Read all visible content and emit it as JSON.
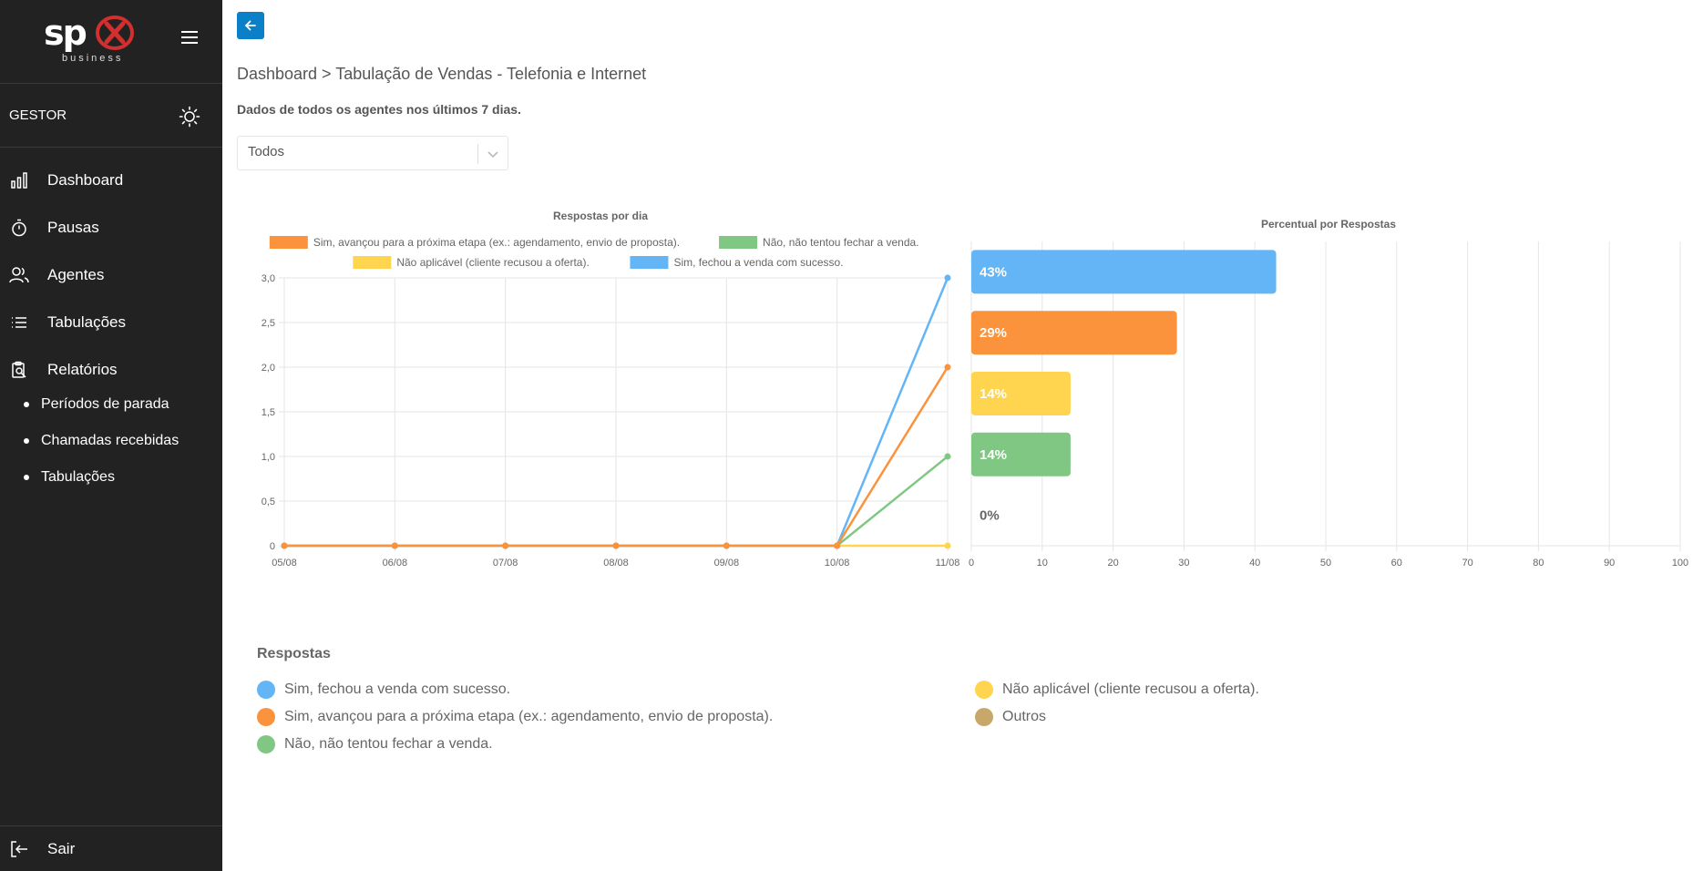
{
  "brand": {
    "logo_main": "sp",
    "logo_sub": "business"
  },
  "sidebar": {
    "role": "GESTOR",
    "items": [
      {
        "label": "Dashboard",
        "icon": "bar-chart-icon"
      },
      {
        "label": "Pausas",
        "icon": "stopwatch-icon"
      },
      {
        "label": "Agentes",
        "icon": "users-icon"
      },
      {
        "label": "Tabulações",
        "icon": "list-icon"
      },
      {
        "label": "Relatórios",
        "icon": "clipboard-search-icon"
      }
    ],
    "subitems": [
      {
        "label": "Períodos de parada"
      },
      {
        "label": "Chamadas recebidas"
      },
      {
        "label": "Tabulações"
      }
    ],
    "logout_label": "Sair"
  },
  "header": {
    "breadcrumb": "Dashboard > Tabulação de Vendas - Telefonia e Internet",
    "subtitle": "Dados de todos os agentes nos últimos 7 dias."
  },
  "filter": {
    "value": "Todos"
  },
  "colors": {
    "blue": "#64b5f6",
    "orange": "#fb923c",
    "green": "#81c784",
    "yellow": "#ffd54f",
    "tan": "#c8a86a"
  },
  "chart_data": [
    {
      "type": "line",
      "title": "Respostas por dia",
      "categories": [
        "05/08",
        "06/08",
        "07/08",
        "08/08",
        "09/08",
        "10/08",
        "11/08"
      ],
      "ylim": [
        0,
        3
      ],
      "yticks": [
        "0",
        "0,5",
        "1,0",
        "1,5",
        "2,0",
        "2,5",
        "3,0"
      ],
      "grid": true,
      "legend_position": "top",
      "series": [
        {
          "name": "Sim, avançou para a próxima etapa (ex.: agendamento, envio de proposta).",
          "color": "#fb923c",
          "values": [
            0,
            0,
            0,
            0,
            0,
            0,
            2
          ]
        },
        {
          "name": "Não, não tentou fechar a venda.",
          "color": "#81c784",
          "values": [
            0,
            0,
            0,
            0,
            0,
            0,
            1
          ]
        },
        {
          "name": "Não aplicável (cliente recusou a oferta).",
          "color": "#ffd54f",
          "values": [
            0,
            0,
            0,
            0,
            0,
            0,
            0
          ]
        },
        {
          "name": "Sim, fechou a venda com sucesso.",
          "color": "#64b5f6",
          "values": [
            0,
            0,
            0,
            0,
            0,
            0,
            3
          ]
        }
      ]
    },
    {
      "type": "bar",
      "orientation": "horizontal",
      "title": "Percentual por Respostas",
      "categories": [
        "Sim, fechou a venda com sucesso.",
        "Sim, avançou para a próxima etapa (ex.: agendamento, envio de proposta).",
        "Não aplicável (cliente recusou a oferta).",
        "Não, não tentou fechar a venda.",
        "Outros"
      ],
      "values": [
        43,
        29,
        14,
        14,
        0
      ],
      "data_labels": [
        "43%",
        "29%",
        "14%",
        "14%",
        "0%"
      ],
      "colors": [
        "#64b5f6",
        "#fb923c",
        "#ffd54f",
        "#81c784",
        "#c8a86a"
      ],
      "xlim": [
        0,
        100
      ],
      "xticks": [
        "0",
        "10",
        "20",
        "30",
        "40",
        "50",
        "60",
        "70",
        "80",
        "90",
        "100"
      ],
      "grid": true
    }
  ],
  "responses": {
    "title": "Respostas",
    "items": [
      {
        "label": "Sim, fechou a venda com sucesso.",
        "color": "#64b5f6"
      },
      {
        "label": "Sim, avançou para a próxima etapa (ex.: agendamento, envio de proposta).",
        "color": "#fb923c"
      },
      {
        "label": "Não, não tentou fechar a venda.",
        "color": "#81c784"
      },
      {
        "label": "Não aplicável (cliente recusou a oferta).",
        "color": "#ffd54f"
      },
      {
        "label": "Outros",
        "color": "#c8a86a"
      }
    ]
  }
}
